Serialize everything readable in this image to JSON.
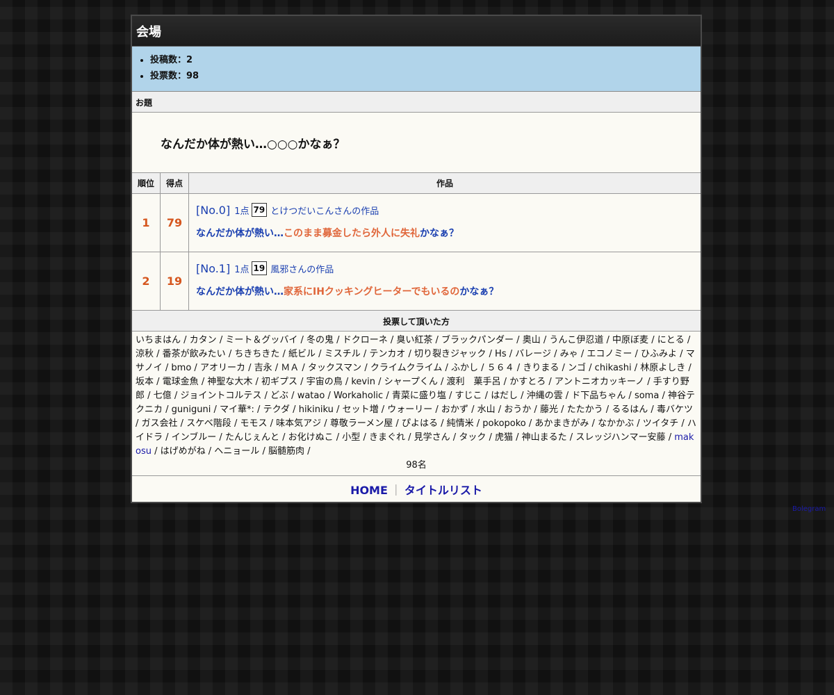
{
  "venue": {
    "title": "会場"
  },
  "stats": [
    {
      "label": "投稿数：2"
    },
    {
      "label": "投票数：98"
    }
  ],
  "theme": {
    "header": "お題",
    "text": "なんだか体が熱い…○○○かなぁ？"
  },
  "results": {
    "columns": [
      "順位",
      "得点",
      "作品"
    ],
    "rows": [
      {
        "rank": "1",
        "score": "79",
        "no": "[No.0]",
        "points_label": "1点",
        "points_box": "79",
        "author": "とけつだいこんさんの作品",
        "prefix": "なんだか体が熱い…",
        "fill": "このまま募金したら外人に失礼",
        "suffix": "かなぁ？"
      },
      {
        "rank": "2",
        "score": "19",
        "no": "[No.1]",
        "points_label": "1点",
        "points_box": "19",
        "author": "風邪さんの作品",
        "prefix": "なんだか体が熱い…",
        "fill": "家系にIHクッキングヒーターでもいるの",
        "suffix": "かなぁ？"
      }
    ]
  },
  "voters": {
    "header": "投票して頂いた方",
    "names": [
      "いちまはん",
      "カタン",
      "ミート＆グッバイ",
      "冬の鬼",
      "ドクローネ",
      "臭い紅茶",
      "ブラックパンダー",
      "奥山",
      "うんこ伊忍道",
      "中原ぼ麦",
      "にとる",
      "涼秋",
      "番茶が飲みたい",
      "ちきちきた",
      "紙ビル",
      "ミスチル",
      "テンカオ",
      "切り裂きジャック",
      "Hs",
      "バレージ",
      "みゃ",
      "エコノミー",
      "ひふみよ",
      "マサノイ",
      "bmo",
      "アオリーカ",
      "吉永",
      "ＭＡ",
      "タックスマン",
      "クライムクライム",
      "ふかし",
      "５６４",
      "きりまる",
      "ンゴ",
      "chikashi",
      "林原よしき",
      "坂本",
      "電球金魚",
      "神聖な大木",
      "初ギプス",
      "宇宙の鳥",
      "kevin",
      "シャープくん",
      "渡利　菓手呂",
      "かすとろ",
      "アントニオカッキーノ",
      "手すり野郎",
      "七億",
      "ジョイントコルテス",
      "どぶ",
      "watao",
      "Workaholic",
      "青菜に盛り塩",
      "すじこ",
      "はだし",
      "沖縄の雲",
      "ド下品ちゃん",
      "soma",
      "神谷テクニカ",
      "guniguni",
      "マイ華*:",
      "テクダ",
      "hikiniku",
      "セット増",
      "ウォーリー",
      "おかず",
      "水山",
      "おうか",
      "藤光",
      "たたかう",
      "るるはん",
      "毒バケツ",
      "ガス会社",
      "スケベ階段",
      "モモス",
      "味本気アジ",
      "尊敬ラーメン屋",
      "ぴよはる",
      "純情米",
      "pokopoko",
      "あかまきがみ",
      "なかかぶ",
      "ツイタチ",
      "ハイドラ",
      "インブルー",
      "たんじぇんと",
      "お化けぬこ",
      "小型",
      "きまぐれ",
      "見学さん",
      "タック",
      "虎猫",
      "神山まるた",
      "スレッジハンマー安藤",
      "makosu",
      "はげめがね",
      "ヘニョール",
      "脳髄筋肉"
    ],
    "link_names": [
      "makosu"
    ],
    "count": "98名"
  },
  "footer": {
    "home": "HOME",
    "divider": "｜",
    "title_list": "タイトルリスト"
  },
  "credit": "Bolegram"
}
